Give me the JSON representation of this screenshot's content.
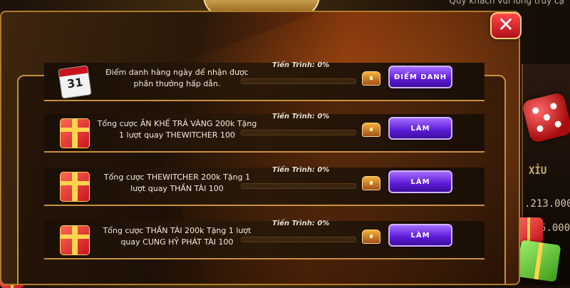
{
  "background": {
    "top_right_text": "Quý khách vui lòng truy cậ",
    "side_texts": [
      "XỈU",
      ".213.000",
      "5.000"
    ]
  },
  "close_label": "✕",
  "tasks": [
    {
      "icon": "calendar-icon",
      "calendar_day": "31",
      "description": "Điểm danh hàng ngày để nhận được phần thưởng hấp dẫn.",
      "progress_label": "Tiến Trình: 0%",
      "progress": 0,
      "button_label": "ĐIỂM DANH"
    },
    {
      "icon": "gift-icon",
      "description": "Tổng cược ĂN KHẾ TRẢ VÀNG 200k Tặng 1 lượt quay THEWITCHER 100",
      "progress_label": "Tiến Trình: 0%",
      "progress": 0,
      "button_label": "LÀM"
    },
    {
      "icon": "gift-icon",
      "description": "Tổng cược THEWITCHER 200k Tặng 1 lượt quay THẦN TÀI 100",
      "progress_label": "Tiến Trình: 0%",
      "progress": 0,
      "button_label": "LÀM"
    },
    {
      "icon": "gift-icon",
      "description": "Tổng cược THẦN TÀI 200k Tặng 1 lượt quay CUNG HỶ PHÁT TÀI 100",
      "progress_label": "Tiến Trình: 0%",
      "progress": 0,
      "button_label": "LÀM"
    }
  ]
}
